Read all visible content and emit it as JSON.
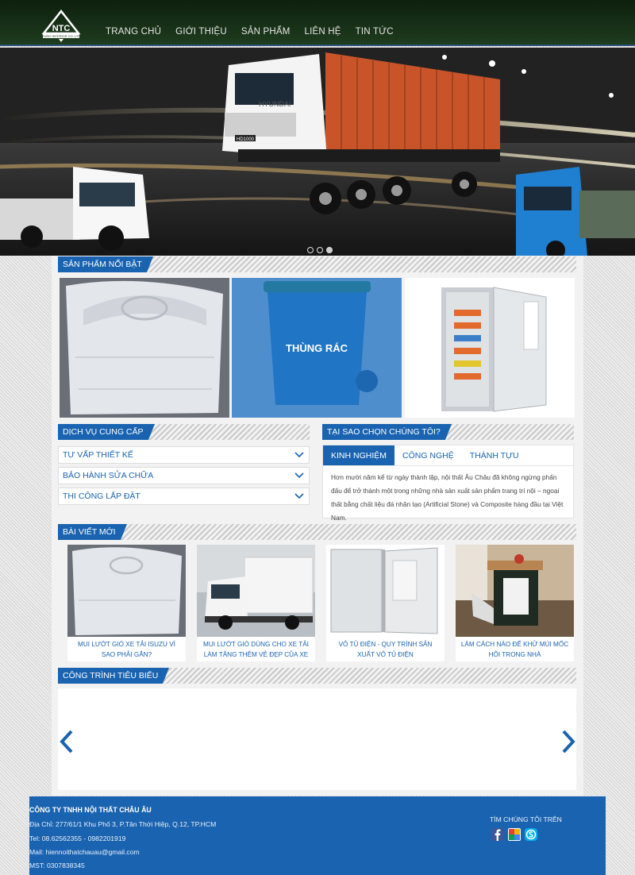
{
  "header": {
    "logo_text": "NTC",
    "logo_subtext": "EURO INTERIOR CO.,LTD",
    "nav": [
      "TRANG CHỦ",
      "GIỚI THIỆU",
      "SẢN PHẨM",
      "LIÊN HỆ",
      "TIN TỨC"
    ]
  },
  "hero": {
    "truck_brand": "HYUNDAI",
    "truck_model": "HD1000",
    "slides_total": 3,
    "active_slide": 3
  },
  "featured": {
    "title": "SẢN PHẨM NỔI BẬT",
    "items": [
      {
        "overlay_label": ""
      },
      {
        "overlay_label": "THÙNG RÁC"
      },
      {
        "overlay_label": ""
      }
    ]
  },
  "services": {
    "title": "DỊCH VỤ CUNG CẤP",
    "items": [
      "TƯ VẤP THIẾT KẾ",
      "BẢO HÀNH SỬA CHỮA",
      "THI CÔNG LẮP ĐẶT"
    ]
  },
  "why": {
    "title": "TẠI SAO CHỌN CHÚNG TÔI?",
    "tabs": [
      "KINH NGHIỆM",
      "CÔNG NGHỆ",
      "THÀNH TỰU"
    ],
    "active_tab": 0,
    "text": "Hơn mười năm kể từ ngày thành lập, nội thất Âu Châu đã không ngừng phấn đấu để trở thành một trong những nhà sản xuất sản phẩm trang trí nội – ngoại thất bằng chất liệu đá nhân tạo (Artificial Stone) và Composite hàng đầu tại Việt Nam."
  },
  "news": {
    "title": "BÀI VIẾT MỚI",
    "items": [
      {
        "title": "MUI LƯỚT GIÓ XE TẢI ISUZU VÌ SAO PHẢI GẮN?"
      },
      {
        "title": "MUI LƯỚT GIÓ DÙNG CHO XE TẢI LÀM TĂNG THÊM VẺ ĐẸP CỦA XE"
      },
      {
        "title": "VỎ TỦ ĐIỆN - QUY TRÌNH SẢN XUẤT VỎ TỦ ĐIỆN"
      },
      {
        "title": "LÀM CÁCH NÀO ĐỂ KHỬ MÙI MỐC HÔI TRONG NHÀ"
      }
    ]
  },
  "projects": {
    "title": "CÔNG TRÌNH TIÊU BIỂU"
  },
  "footer": {
    "company": "CÔNG TY TNHH NỘI THẤT CHÂU ÂU",
    "address": "Địa Chỉ: 277/61/1 Khu Phố 3, P.Tân Thới Hiệp, Q.12, TP.HCM",
    "phone": "Tel: 08.62562355 - 0982201919",
    "mail": "Mail: hiennoithatchauau@gmail.com",
    "mst": "MST: 0307838345",
    "find_us": "TÌM CHÚNG TÔI TRÊN"
  },
  "colors": {
    "accent": "#1a63b0",
    "header_bg": "#173017",
    "footer_bg": "#1a63b0"
  }
}
